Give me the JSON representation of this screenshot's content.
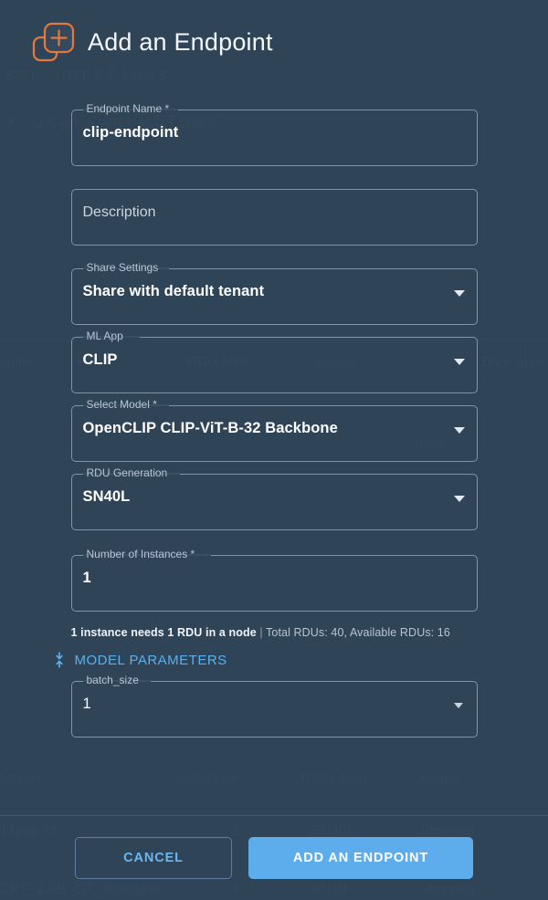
{
  "background": {
    "heading_fragment": "user workflows.",
    "breadcrumb_fragment": "/ user-workflows",
    "table_headers_top": [
      "cription",
      "RDUs",
      "RDU Arch",
      "Status",
      "Date Subm"
    ],
    "table_headers_mid": [
      "Model",
      "Instances",
      "RDU Arch",
      "Status"
    ],
    "ghost_row_word": "rows",
    "rows": [
      {
        "model": "Llava 7b",
        "instances": "1",
        "rdu_arch": "SN40L",
        "status": "Stopped"
      },
      {
        "model": "GPT_1.5B_GT_Finetune",
        "instances": "1",
        "rdu_arch": "SN10",
        "status": "Stopped"
      }
    ]
  },
  "header": {
    "title": "Add an Endpoint",
    "icon": "add-square-icon",
    "icon_color": "#e07a3f"
  },
  "form": {
    "endpoint_name": {
      "label": "Endpoint Name *",
      "value": "clip-endpoint",
      "type": "text"
    },
    "description": {
      "label": "",
      "placeholder": "Description",
      "value": "",
      "type": "text"
    },
    "share_settings": {
      "label": "Share Settings",
      "value": "Share with default tenant",
      "type": "select"
    },
    "ml_app": {
      "label": "ML App",
      "value": "CLIP",
      "type": "select"
    },
    "select_model": {
      "label": "Select Model *",
      "value": "OpenCLIP CLIP-ViT-B-32 Backbone",
      "type": "select"
    },
    "rdu_generation": {
      "label": "RDU Generation",
      "value": "SN40L",
      "type": "select"
    },
    "number_of_instances": {
      "label": "Number of Instances *",
      "value": "1",
      "type": "number"
    },
    "batch_size": {
      "label": "batch_size",
      "value": "1",
      "type": "select"
    }
  },
  "info": {
    "strong": "1 instance needs 1 RDU in a node",
    "separator": " | ",
    "rest": "Total RDUs: 40, Available RDUs: 16"
  },
  "model_parameters": {
    "label": "MODEL PARAMETERS",
    "icon": "unfold-less-icon",
    "expanded": true,
    "accent": "#5ab0ec"
  },
  "footer": {
    "cancel_label": "CANCEL",
    "submit_label": "ADD AN ENDPOINT",
    "submit_color": "#5dadec"
  }
}
